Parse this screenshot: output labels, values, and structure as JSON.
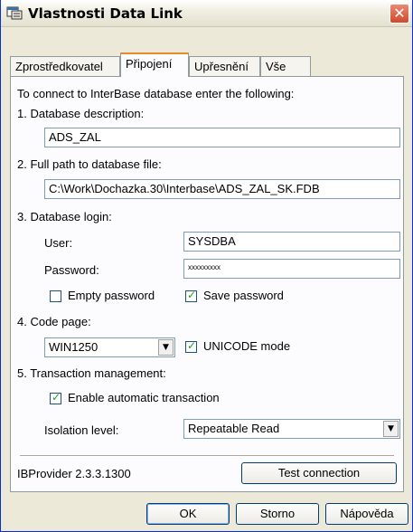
{
  "window": {
    "title": "Vlastnosti Data Link",
    "close_glyph": "✕",
    "icon": "data-link-icon"
  },
  "tabs": [
    {
      "label": "Zprostředkovatel"
    },
    {
      "label": "Připojení",
      "active": true
    },
    {
      "label": "Upřesnění"
    },
    {
      "label": "Vše"
    }
  ],
  "connection": {
    "intro": "To connect to InterBase database enter the following:",
    "description_label": "1. Database description:",
    "description_value": "ADS_ZAL",
    "path_label": "2. Full path to database file:",
    "path_value": "C:\\Work\\Dochazka.30\\Interbase\\ADS_ZAL_SK.FDB",
    "login_label": "3. Database login:",
    "user_label": "User:",
    "user_value": "SYSDBA",
    "password_label": "Password:",
    "password_value": "xxxxxxxxx",
    "empty_password_label": "Empty password",
    "empty_password_checked": false,
    "save_password_label": "Save password",
    "save_password_checked": true,
    "codepage_label": "4. Code page:",
    "codepage_value": "WIN1250",
    "unicode_label": "UNICODE mode",
    "unicode_checked": true,
    "transaction_label": "5. Transaction management:",
    "auto_transaction_label": "Enable automatic transaction",
    "auto_transaction_checked": true,
    "isolation_label": "Isolation level:",
    "isolation_value": "Repeatable Read",
    "version": "IBProvider 2.3.3.1300",
    "test_button": "Test connection"
  },
  "footer": {
    "ok": "OK",
    "cancel": "Storno",
    "help": "Nápověda"
  },
  "check_glyph": "✓",
  "arrow_glyph": "▼"
}
